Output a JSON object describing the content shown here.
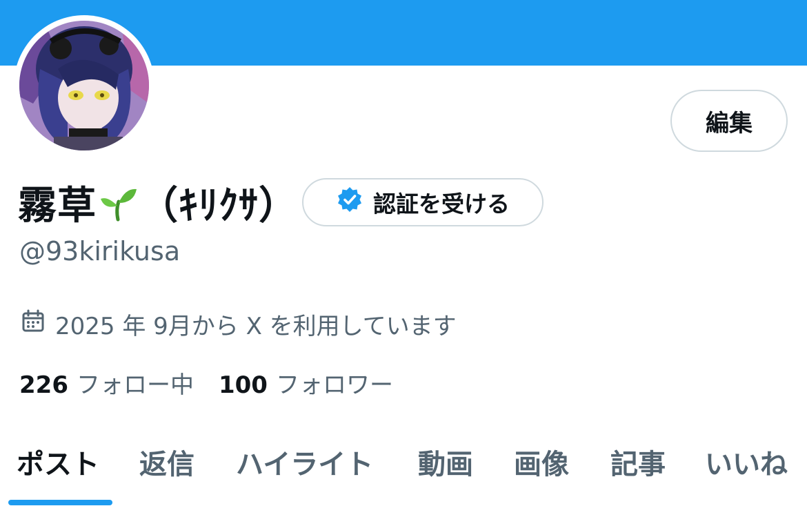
{
  "colors": {
    "banner": "#1d9bf0",
    "accent": "#1d9bf0",
    "text_primary": "#0f1419",
    "text_secondary": "#536471",
    "border": "#cfd9de"
  },
  "profile": {
    "display_name_kanji": "霧草",
    "display_name_reading": "（ｷﾘｸｻ）",
    "name_emoji": "sprout-icon",
    "handle": "@93kirikusa",
    "joined": "2025 年 9月から X を利用しています",
    "joined_icon": "calendar-icon"
  },
  "actions": {
    "edit_label": "編集",
    "verify_label": "認証を受ける",
    "verify_icon": "verified-badge-icon"
  },
  "stats": {
    "following_count": "226",
    "following_label": "フォロー中",
    "followers_count": "100",
    "followers_label": "フォロワー"
  },
  "tabs": [
    {
      "label": "ポスト",
      "active": true
    },
    {
      "label": "返信",
      "active": false
    },
    {
      "label": "ハイライト",
      "active": false
    },
    {
      "label": "動画",
      "active": false
    },
    {
      "label": "画像",
      "active": false
    },
    {
      "label": "記事",
      "active": false
    },
    {
      "label": "いいね",
      "active": false
    }
  ]
}
